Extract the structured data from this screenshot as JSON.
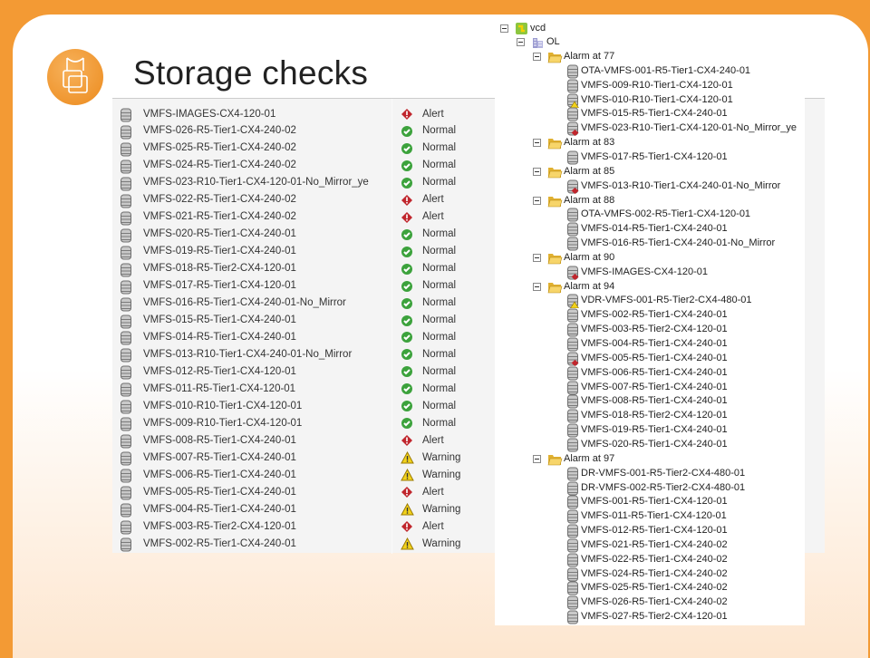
{
  "slide": {
    "title": "Storage checks"
  },
  "colors": {
    "background": "#f39a34",
    "alert": "#c0262d",
    "normal": "#3ca23c",
    "warning": "#f2d21b"
  },
  "datastore_list": [
    {
      "name": "VMFS-IMAGES-CX4-120-01",
      "status": "Alert"
    },
    {
      "name": "VMFS-026-R5-Tier1-CX4-240-02",
      "status": "Normal"
    },
    {
      "name": "VMFS-025-R5-Tier1-CX4-240-02",
      "status": "Normal"
    },
    {
      "name": "VMFS-024-R5-Tier1-CX4-240-02",
      "status": "Normal"
    },
    {
      "name": "VMFS-023-R10-Tier1-CX4-120-01-No_Mirror_ye",
      "status": "Normal"
    },
    {
      "name": "VMFS-022-R5-Tier1-CX4-240-02",
      "status": "Alert"
    },
    {
      "name": "VMFS-021-R5-Tier1-CX4-240-02",
      "status": "Alert"
    },
    {
      "name": "VMFS-020-R5-Tier1-CX4-240-01",
      "status": "Normal"
    },
    {
      "name": "VMFS-019-R5-Tier1-CX4-240-01",
      "status": "Normal"
    },
    {
      "name": "VMFS-018-R5-Tier2-CX4-120-01",
      "status": "Normal"
    },
    {
      "name": "VMFS-017-R5-Tier1-CX4-120-01",
      "status": "Normal"
    },
    {
      "name": "VMFS-016-R5-Tier1-CX4-240-01-No_Mirror",
      "status": "Normal"
    },
    {
      "name": "VMFS-015-R5-Tier1-CX4-240-01",
      "status": "Normal"
    },
    {
      "name": "VMFS-014-R5-Tier1-CX4-240-01",
      "status": "Normal"
    },
    {
      "name": "VMFS-013-R10-Tier1-CX4-240-01-No_Mirror",
      "status": "Normal"
    },
    {
      "name": "VMFS-012-R5-Tier1-CX4-120-01",
      "status": "Normal"
    },
    {
      "name": "VMFS-011-R5-Tier1-CX4-120-01",
      "status": "Normal"
    },
    {
      "name": "VMFS-010-R10-Tier1-CX4-120-01",
      "status": "Normal"
    },
    {
      "name": "VMFS-009-R10-Tier1-CX4-120-01",
      "status": "Normal"
    },
    {
      "name": "VMFS-008-R5-Tier1-CX4-240-01",
      "status": "Alert"
    },
    {
      "name": "VMFS-007-R5-Tier1-CX4-240-01",
      "status": "Warning"
    },
    {
      "name": "VMFS-006-R5-Tier1-CX4-240-01",
      "status": "Warning"
    },
    {
      "name": "VMFS-005-R5-Tier1-CX4-240-01",
      "status": "Alert"
    },
    {
      "name": "VMFS-004-R5-Tier1-CX4-240-01",
      "status": "Warning"
    },
    {
      "name": "VMFS-003-R5-Tier2-CX4-120-01",
      "status": "Alert"
    },
    {
      "name": "VMFS-002-R5-Tier1-CX4-240-01",
      "status": "Warning"
    }
  ],
  "tree": {
    "root": "vcd",
    "datacenter": "OL",
    "groups": [
      {
        "label": "Alarm at 77",
        "items": [
          {
            "name": "OTA-VMFS-001-R5-Tier1-CX4-240-01",
            "badge": ""
          },
          {
            "name": "VMFS-009-R10-Tier1-CX4-120-01",
            "badge": ""
          },
          {
            "name": "VMFS-010-R10-Tier1-CX4-120-01",
            "badge": "warning"
          },
          {
            "name": "VMFS-015-R5-Tier1-CX4-240-01",
            "badge": ""
          },
          {
            "name": "VMFS-023-R10-Tier1-CX4-120-01-No_Mirror_ye",
            "badge": "alert"
          }
        ]
      },
      {
        "label": "Alarm at 83",
        "items": [
          {
            "name": "VMFS-017-R5-Tier1-CX4-120-01",
            "badge": ""
          }
        ]
      },
      {
        "label": "Alarm at 85",
        "items": [
          {
            "name": "VMFS-013-R10-Tier1-CX4-240-01-No_Mirror",
            "badge": "alert"
          }
        ]
      },
      {
        "label": "Alarm at 88",
        "items": [
          {
            "name": "OTA-VMFS-002-R5-Tier1-CX4-120-01",
            "badge": ""
          },
          {
            "name": "VMFS-014-R5-Tier1-CX4-240-01",
            "badge": ""
          },
          {
            "name": "VMFS-016-R5-Tier1-CX4-240-01-No_Mirror",
            "badge": ""
          }
        ]
      },
      {
        "label": "Alarm at 90",
        "items": [
          {
            "name": "VMFS-IMAGES-CX4-120-01",
            "badge": "alert"
          }
        ]
      },
      {
        "label": "Alarm at 94",
        "items": [
          {
            "name": "VDR-VMFS-001-R5-Tier2-CX4-480-01",
            "badge": "warning"
          },
          {
            "name": "VMFS-002-R5-Tier1-CX4-240-01",
            "badge": ""
          },
          {
            "name": "VMFS-003-R5-Tier2-CX4-120-01",
            "badge": ""
          },
          {
            "name": "VMFS-004-R5-Tier1-CX4-240-01",
            "badge": ""
          },
          {
            "name": "VMFS-005-R5-Tier1-CX4-240-01",
            "badge": "alert"
          },
          {
            "name": "VMFS-006-R5-Tier1-CX4-240-01",
            "badge": ""
          },
          {
            "name": "VMFS-007-R5-Tier1-CX4-240-01",
            "badge": ""
          },
          {
            "name": "VMFS-008-R5-Tier1-CX4-240-01",
            "badge": ""
          },
          {
            "name": "VMFS-018-R5-Tier2-CX4-120-01",
            "badge": ""
          },
          {
            "name": "VMFS-019-R5-Tier1-CX4-240-01",
            "badge": ""
          },
          {
            "name": "VMFS-020-R5-Tier1-CX4-240-01",
            "badge": ""
          }
        ]
      },
      {
        "label": "Alarm at 97",
        "items": [
          {
            "name": "DR-VMFS-001-R5-Tier2-CX4-480-01",
            "badge": ""
          },
          {
            "name": "DR-VMFS-002-R5-Tier2-CX4-480-01",
            "badge": ""
          },
          {
            "name": "VMFS-001-R5-Tier1-CX4-120-01",
            "badge": ""
          },
          {
            "name": "VMFS-011-R5-Tier1-CX4-120-01",
            "badge": ""
          },
          {
            "name": "VMFS-012-R5-Tier1-CX4-120-01",
            "badge": ""
          },
          {
            "name": "VMFS-021-R5-Tier1-CX4-240-02",
            "badge": ""
          },
          {
            "name": "VMFS-022-R5-Tier1-CX4-240-02",
            "badge": ""
          },
          {
            "name": "VMFS-024-R5-Tier1-CX4-240-02",
            "badge": ""
          },
          {
            "name": "VMFS-025-R5-Tier1-CX4-240-02",
            "badge": ""
          },
          {
            "name": "VMFS-026-R5-Tier1-CX4-240-02",
            "badge": ""
          },
          {
            "name": "VMFS-027-R5-Tier2-CX4-120-01",
            "badge": ""
          }
        ]
      }
    ]
  }
}
